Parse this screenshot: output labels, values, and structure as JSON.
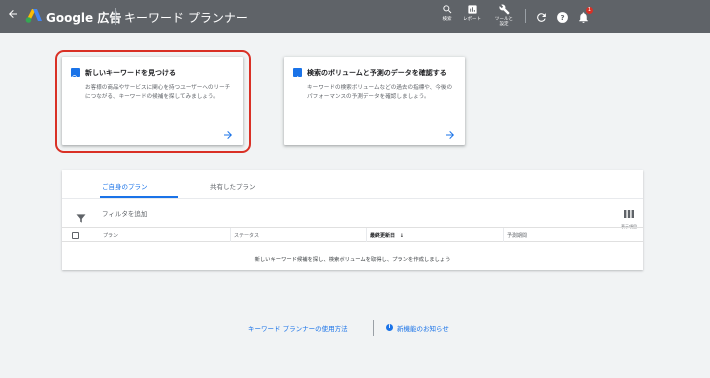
{
  "header": {
    "brand": "Google 広告",
    "title": "キーワード プランナー",
    "tools": [
      {
        "icon": "search-icon",
        "label": "検索"
      },
      {
        "icon": "reports-icon",
        "label": "レポート"
      },
      {
        "icon": "wrench-icon",
        "label_line1": "ツールと",
        "label_line2": "設定"
      }
    ],
    "notification_count": "1"
  },
  "cards": {
    "find": {
      "title": "新しいキーワードを見つける",
      "description": "お客様の商品やサービスに関心を持つユーザーへのリーチにつながる、キーワードの候補を探してみましょう。"
    },
    "forecast": {
      "title": "検索のボリュームと予測のデータを確認する",
      "description": "キーワードの検索ボリュームなどの過去の指標や、今後のパフォーマンスの予測データを確認しましょう。"
    }
  },
  "plans": {
    "tabs": [
      "ご自身のプラン",
      "共有したプラン"
    ],
    "active_tab": 0,
    "filter_label": "フィルタを追加",
    "columns_label": "表示項目",
    "columns": [
      "プラン",
      "ステータス",
      "最終更新日",
      "予測期間"
    ],
    "sort_column": "最終更新日",
    "empty_message": "新しいキーワード候補を探し、検索ボリュームを取得し、プランを作成しましょう"
  },
  "footer": {
    "how_to_link": "キーワード プランナーの使用方法",
    "whats_new_link": "新機能のお知らせ"
  },
  "colors": {
    "topbar": "#5f6368",
    "accent": "#1a73e8",
    "highlight": "#d93025"
  }
}
